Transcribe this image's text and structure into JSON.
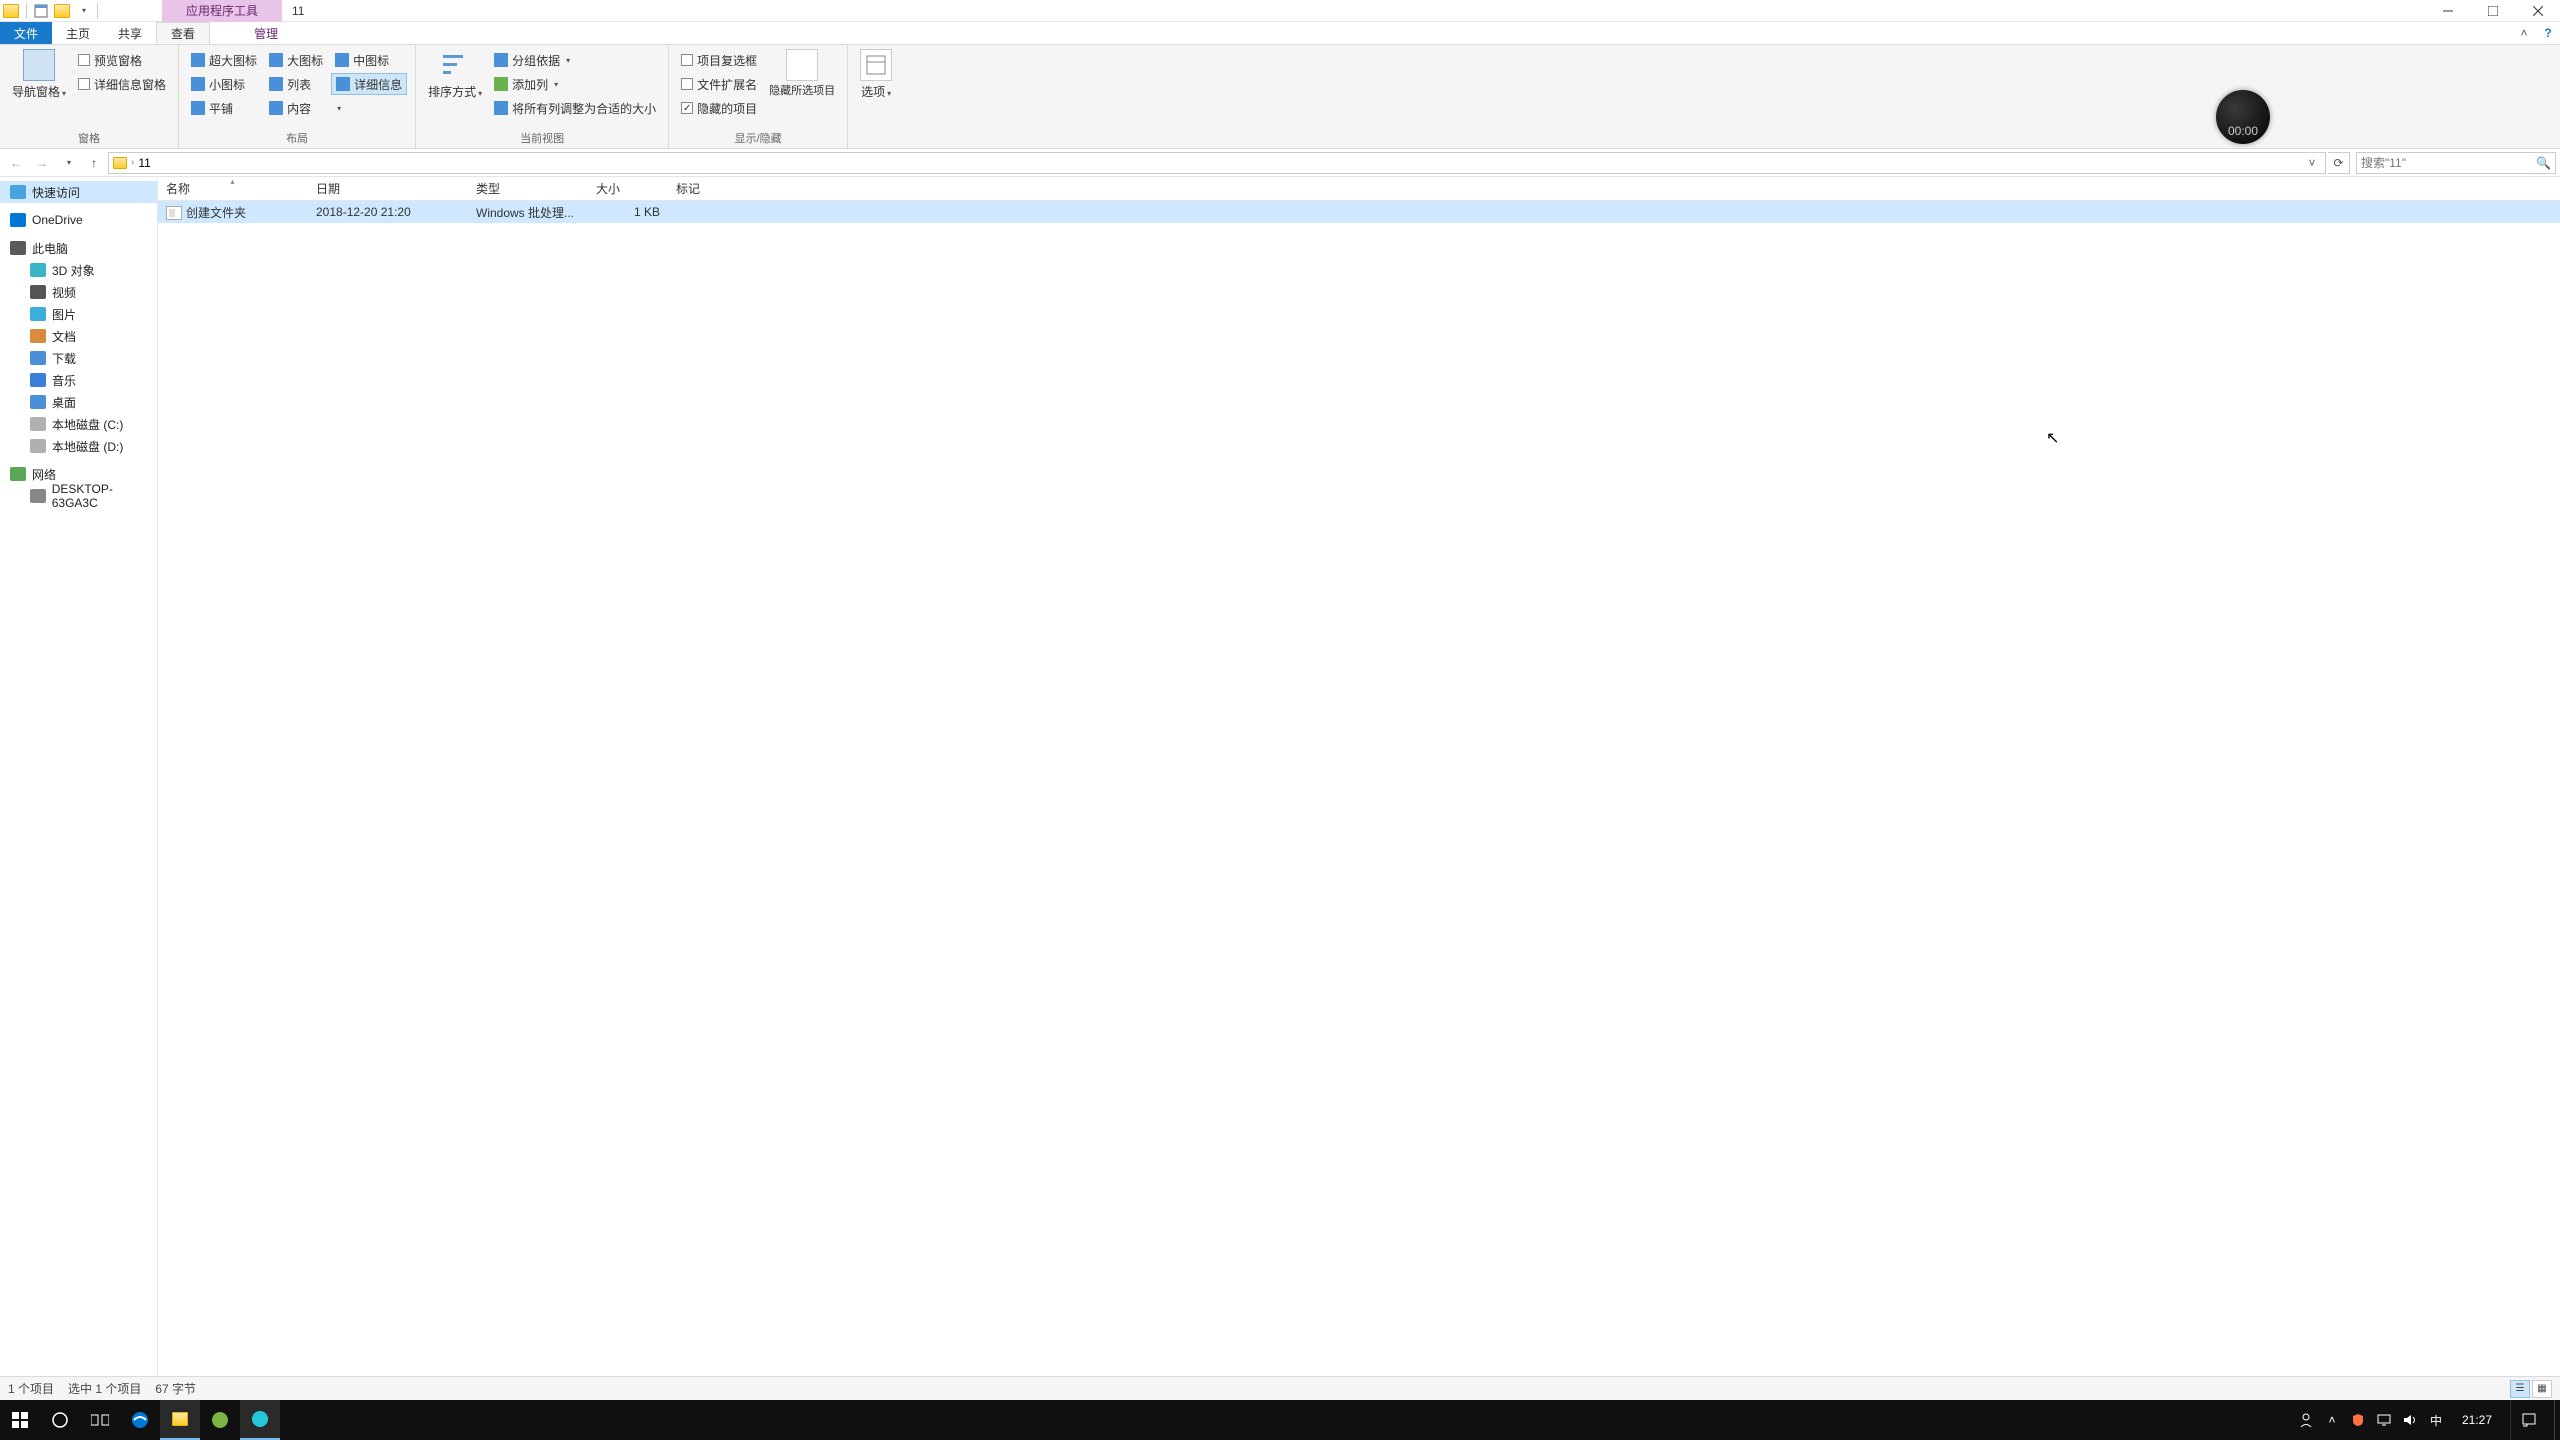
{
  "window": {
    "context_tab": "应用程序工具",
    "title": "11",
    "qat": {
      "props": "属性",
      "new_folder": "新建"
    }
  },
  "tabs": {
    "file": "文件",
    "home": "主页",
    "share": "共享",
    "view": "查看",
    "manage": "管理"
  },
  "ribbon": {
    "panes": {
      "nav_pane": "导航窗格",
      "preview_pane": "预览窗格",
      "details_pane": "详细信息窗格",
      "group_label": "窗格"
    },
    "layout": {
      "extra_large": "超大图标",
      "large": "大图标",
      "medium": "中图标",
      "small": "小图标",
      "list": "列表",
      "details": "详细信息",
      "tiles": "平铺",
      "content": "内容",
      "group_label": "布局"
    },
    "current_view": {
      "sort_by": "排序方式",
      "group_by": "分组依据",
      "add_columns": "添加列",
      "size_all": "将所有列调整为合适的大小",
      "group_label": "当前视图"
    },
    "show_hide": {
      "item_checkboxes": "项目复选框",
      "file_ext": "文件扩展名",
      "hidden_items": "隐藏的项目",
      "hide_selected": "隐藏所选项目",
      "group_label": "显示/隐藏"
    },
    "options": {
      "options": "选项"
    }
  },
  "address": {
    "current": "11",
    "search_placeholder": "搜索\"11\""
  },
  "navtree": {
    "quick_access": "快速访问",
    "onedrive": "OneDrive",
    "this_pc": "此电脑",
    "objects_3d": "3D 对象",
    "videos": "视频",
    "pictures": "图片",
    "documents": "文档",
    "downloads": "下载",
    "music": "音乐",
    "desktop": "桌面",
    "drive_c": "本地磁盘 (C:)",
    "drive_d": "本地磁盘 (D:)",
    "network": "网络",
    "computer": "DESKTOP-63GA3C"
  },
  "columns": {
    "name": "名称",
    "date": "日期",
    "type": "类型",
    "size": "大小",
    "tags": "标记"
  },
  "files": [
    {
      "name": "创建文件夹",
      "date": "2018-12-20 21:20",
      "type": "Windows 批处理...",
      "size": "1 KB",
      "tags": ""
    }
  ],
  "status": {
    "count": "1 个项目",
    "selected": "选中 1 个项目",
    "size": "67 字节"
  },
  "taskbar": {
    "ime": "中",
    "time": "21:27"
  },
  "recorder": {
    "time": "00:00"
  }
}
